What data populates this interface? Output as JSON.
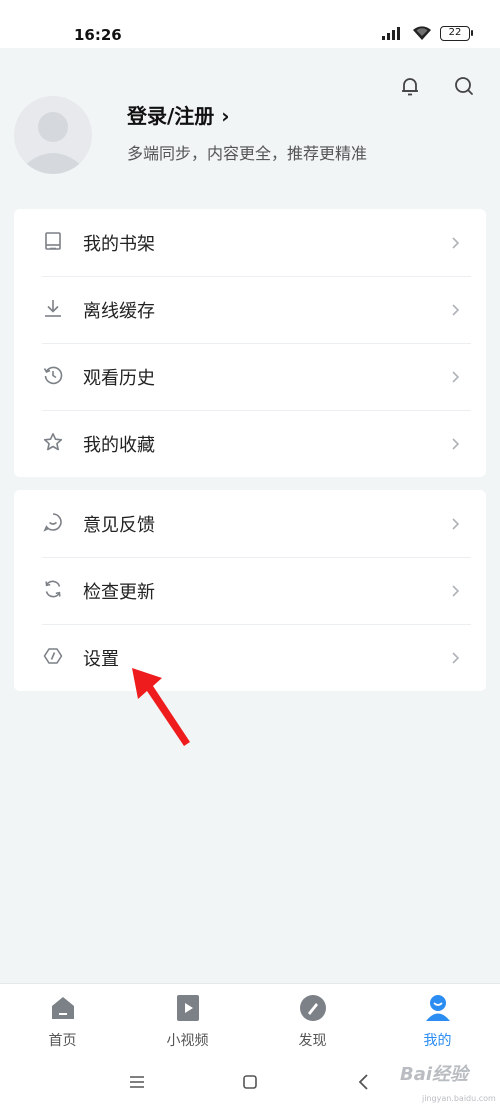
{
  "status_bar": {
    "time": "16:26",
    "battery": "22"
  },
  "header": {
    "bell_icon": "bell-icon",
    "search_icon": "search-icon"
  },
  "profile": {
    "avatar_icon": "avatar-placeholder",
    "login_label": "登录/注册",
    "login_chevron": "›",
    "subtitle": "多端同步，内容更全，推荐更精准"
  },
  "menu_group1": [
    {
      "label": "我的书架",
      "icon": "book-icon"
    },
    {
      "label": "离线缓存",
      "icon": "download-icon"
    },
    {
      "label": "观看历史",
      "icon": "history-icon"
    },
    {
      "label": "我的收藏",
      "icon": "star-icon"
    }
  ],
  "menu_group2": [
    {
      "label": "意见反馈",
      "icon": "feedback-icon"
    },
    {
      "label": "检查更新",
      "icon": "refresh-icon"
    },
    {
      "label": "设置",
      "icon": "settings-icon"
    }
  ],
  "bottom_nav": [
    {
      "label": "首页",
      "icon": "home-icon",
      "active": false
    },
    {
      "label": "小视频",
      "icon": "video-icon",
      "active": false
    },
    {
      "label": "发现",
      "icon": "discover-icon",
      "active": false
    },
    {
      "label": "我的",
      "icon": "profile-icon",
      "active": true
    }
  ],
  "watermark": {
    "text": "Bai经验",
    "sub": "jingyan.baidu.com"
  },
  "colors": {
    "accent": "#2b8cf2",
    "annotation_arrow": "#ee1c1c",
    "page_bg": "#f2f5f6",
    "icon_gray": "#7c8187"
  }
}
